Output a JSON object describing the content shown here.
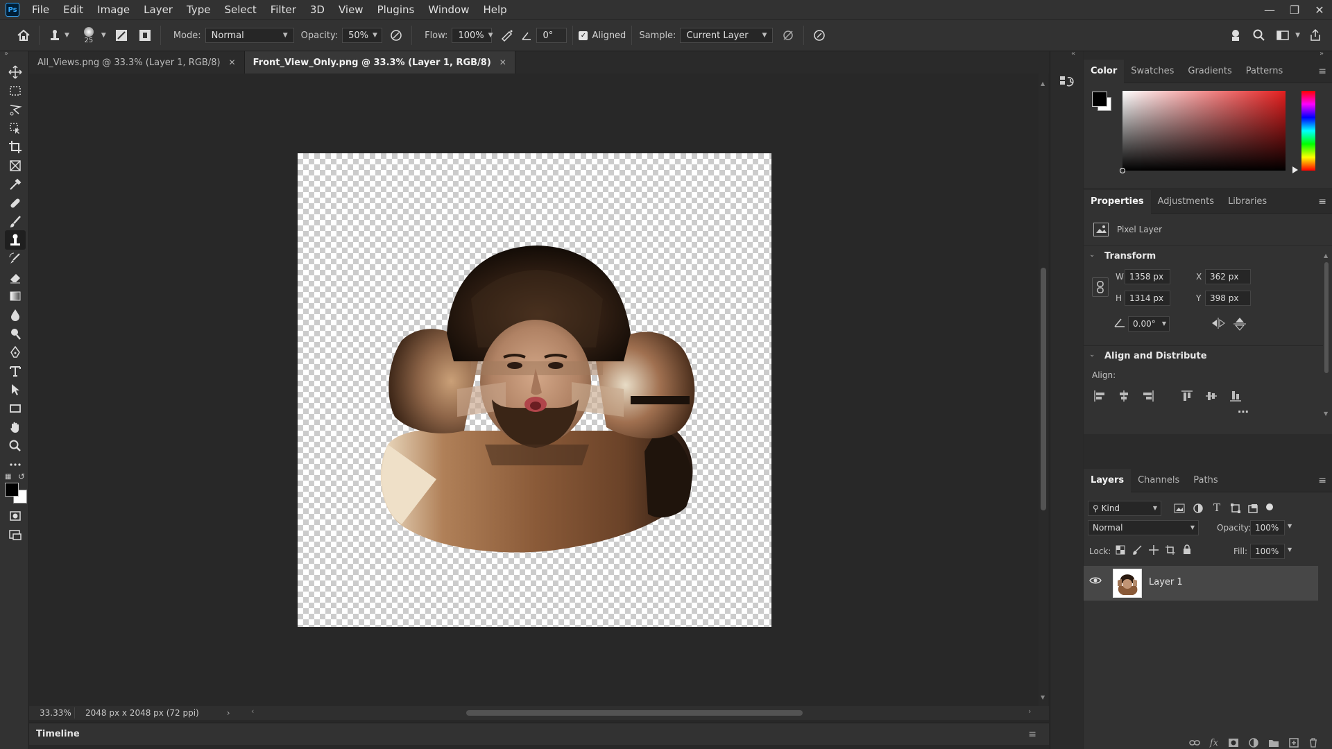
{
  "app": {
    "logo": "Ps"
  },
  "menu": [
    "File",
    "Edit",
    "Image",
    "Layer",
    "Type",
    "Select",
    "Filter",
    "3D",
    "View",
    "Plugins",
    "Window",
    "Help"
  ],
  "options": {
    "brush_size": "25",
    "mode_label": "Mode:",
    "mode_value": "Normal",
    "opacity_label": "Opacity:",
    "opacity_value": "50%",
    "flow_label": "Flow:",
    "flow_value": "100%",
    "angle_value": "0°",
    "aligned_label": "Aligned",
    "sample_label": "Sample:",
    "sample_value": "Current Layer"
  },
  "tabs": [
    {
      "label": "All_Views.png @ 33.3% (Layer 1, RGB/8)",
      "active": false
    },
    {
      "label": "Front_View_Only.png @ 33.3% (Layer 1, RGB/8)",
      "active": true
    }
  ],
  "status": {
    "zoom": "33.33%",
    "doc_info": "2048 px x 2048 px (72 ppi)"
  },
  "timeline": {
    "label": "Timeline"
  },
  "color_panel": {
    "tabs": [
      "Color",
      "Swatches",
      "Gradients",
      "Patterns"
    ]
  },
  "properties_panel": {
    "tabs": [
      "Properties",
      "Adjustments",
      "Libraries"
    ],
    "layer_type": "Pixel Layer",
    "transform_title": "Transform",
    "w_label": "W",
    "w_value": "1358 px",
    "h_label": "H",
    "h_value": "1314 px",
    "x_label": "X",
    "x_value": "362 px",
    "y_label": "Y",
    "y_value": "398 px",
    "angle_value": "0.00°",
    "align_title": "Align and Distribute",
    "align_label": "Align:"
  },
  "layers_panel": {
    "tabs": [
      "Layers",
      "Channels",
      "Paths"
    ],
    "kind_label": "Kind",
    "blend_mode": "Normal",
    "opacity_label": "Opacity:",
    "opacity_value": "100%",
    "lock_label": "Lock:",
    "fill_label": "Fill:",
    "fill_value": "100%",
    "layers": [
      {
        "name": "Layer 1",
        "visible": true
      }
    ]
  },
  "colors": {
    "accent": "#31a8ff",
    "fg": "#000000",
    "bg": "#ffffff"
  }
}
